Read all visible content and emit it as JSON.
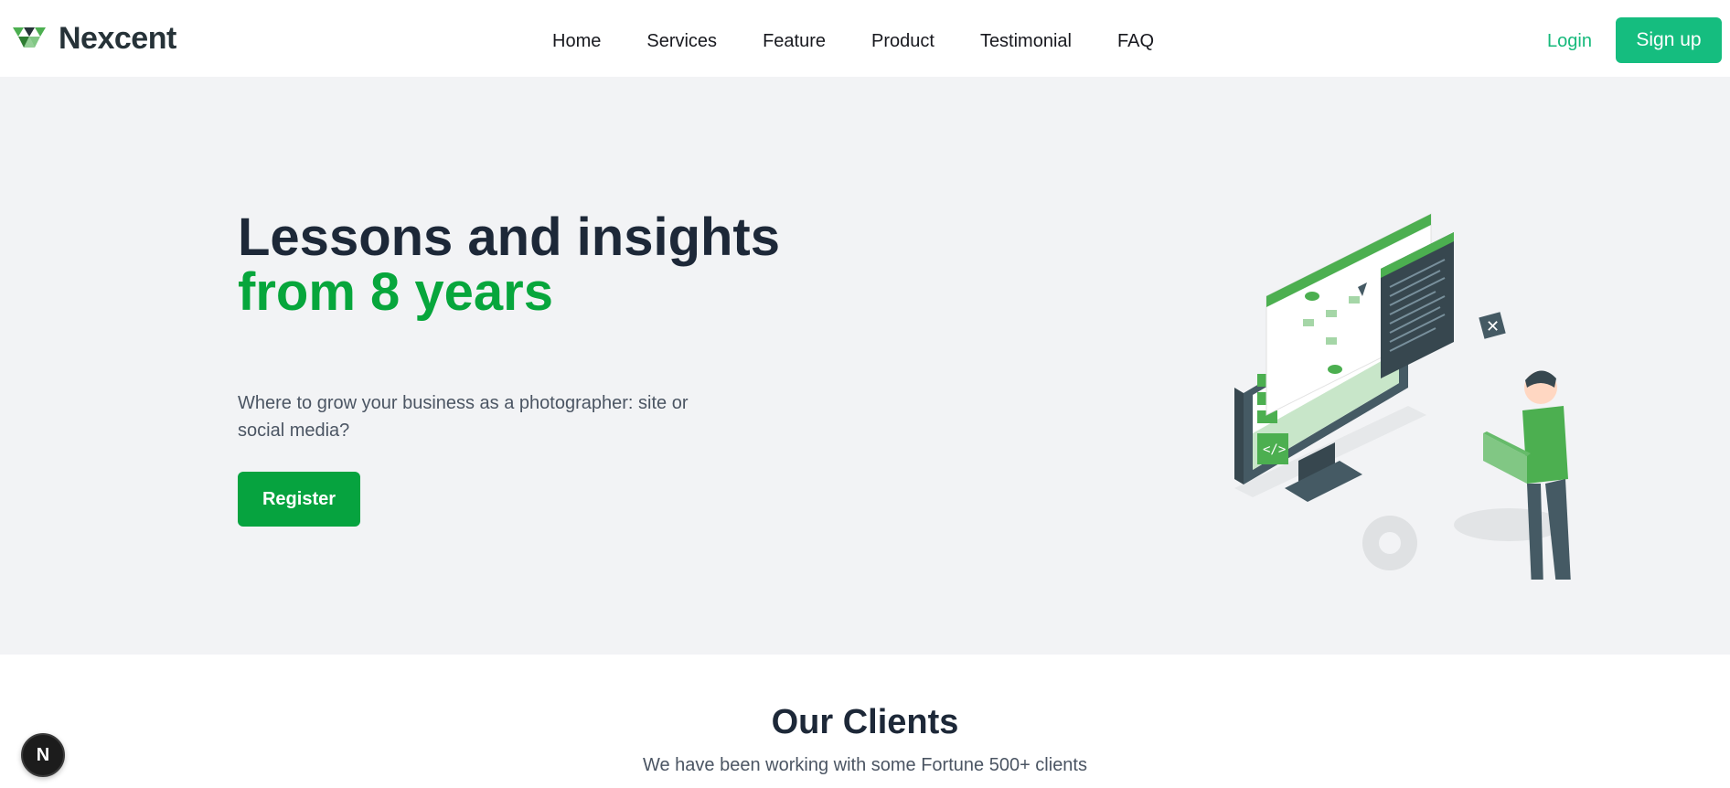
{
  "header": {
    "brand": "Nexcent",
    "nav": [
      {
        "label": "Home"
      },
      {
        "label": "Services"
      },
      {
        "label": "Feature"
      },
      {
        "label": "Product"
      },
      {
        "label": "Testimonial"
      },
      {
        "label": "FAQ"
      }
    ],
    "login_label": "Login",
    "signup_label": "Sign up"
  },
  "hero": {
    "title_line1": "Lessons and insights",
    "title_accent": "from 8 years",
    "subtitle": "Where to grow your business as a photographer: site or social media?",
    "register_label": "Register",
    "illustration_icon": "developer-desktop-illustration"
  },
  "clients": {
    "title": "Our Clients",
    "subtitle": "We have been working with some Fortune 500+ clients"
  },
  "overlay": {
    "badge_label": "N"
  },
  "colors": {
    "brand_green": "#15bd7f",
    "accent_green": "#07a63c",
    "hero_bg": "#f2f3f5",
    "heading": "#1d2838"
  }
}
